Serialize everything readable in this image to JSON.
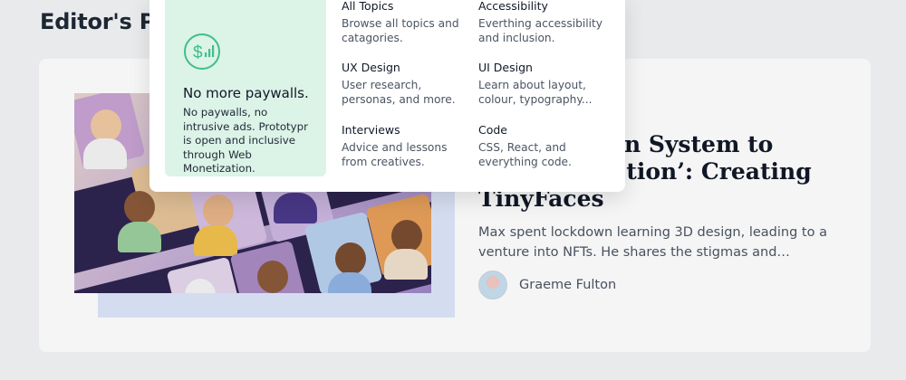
{
  "section": {
    "title": "Editor's Picks"
  },
  "featured": {
    "title": "From Design System to ‘NFT Collection’: Creating TinyFaces",
    "excerpt": "Max spent lockdown learning 3D design, leading to a venture into NFTs. He shares the stigmas and challenges of entering the NFT space as a designer.",
    "author": "Graeme Fulton"
  },
  "menu": {
    "promo": {
      "icon": "dollar-signal-icon",
      "title": "No more paywalls.",
      "text": "No paywalls, no intrusive ads. Prototypr is open and inclusive through Web Monetization."
    },
    "items": [
      {
        "title": "All Topics",
        "desc": "Browse all topics and catagories."
      },
      {
        "title": "Accessibility",
        "desc": "Everthing accessibility and inclusion."
      },
      {
        "title": "UX Design",
        "desc": "User research, personas, and more."
      },
      {
        "title": "UI Design",
        "desc": "Learn about layout, colour, typography..."
      },
      {
        "title": "Interviews",
        "desc": "Advice and lessons from creatives."
      },
      {
        "title": "Code",
        "desc": "CSS, React, and everything code."
      }
    ]
  },
  "colors": {
    "promo_bg": "#dcf3e7",
    "accent_green": "#3fbf86",
    "image_shadow": "#dde6f9"
  }
}
